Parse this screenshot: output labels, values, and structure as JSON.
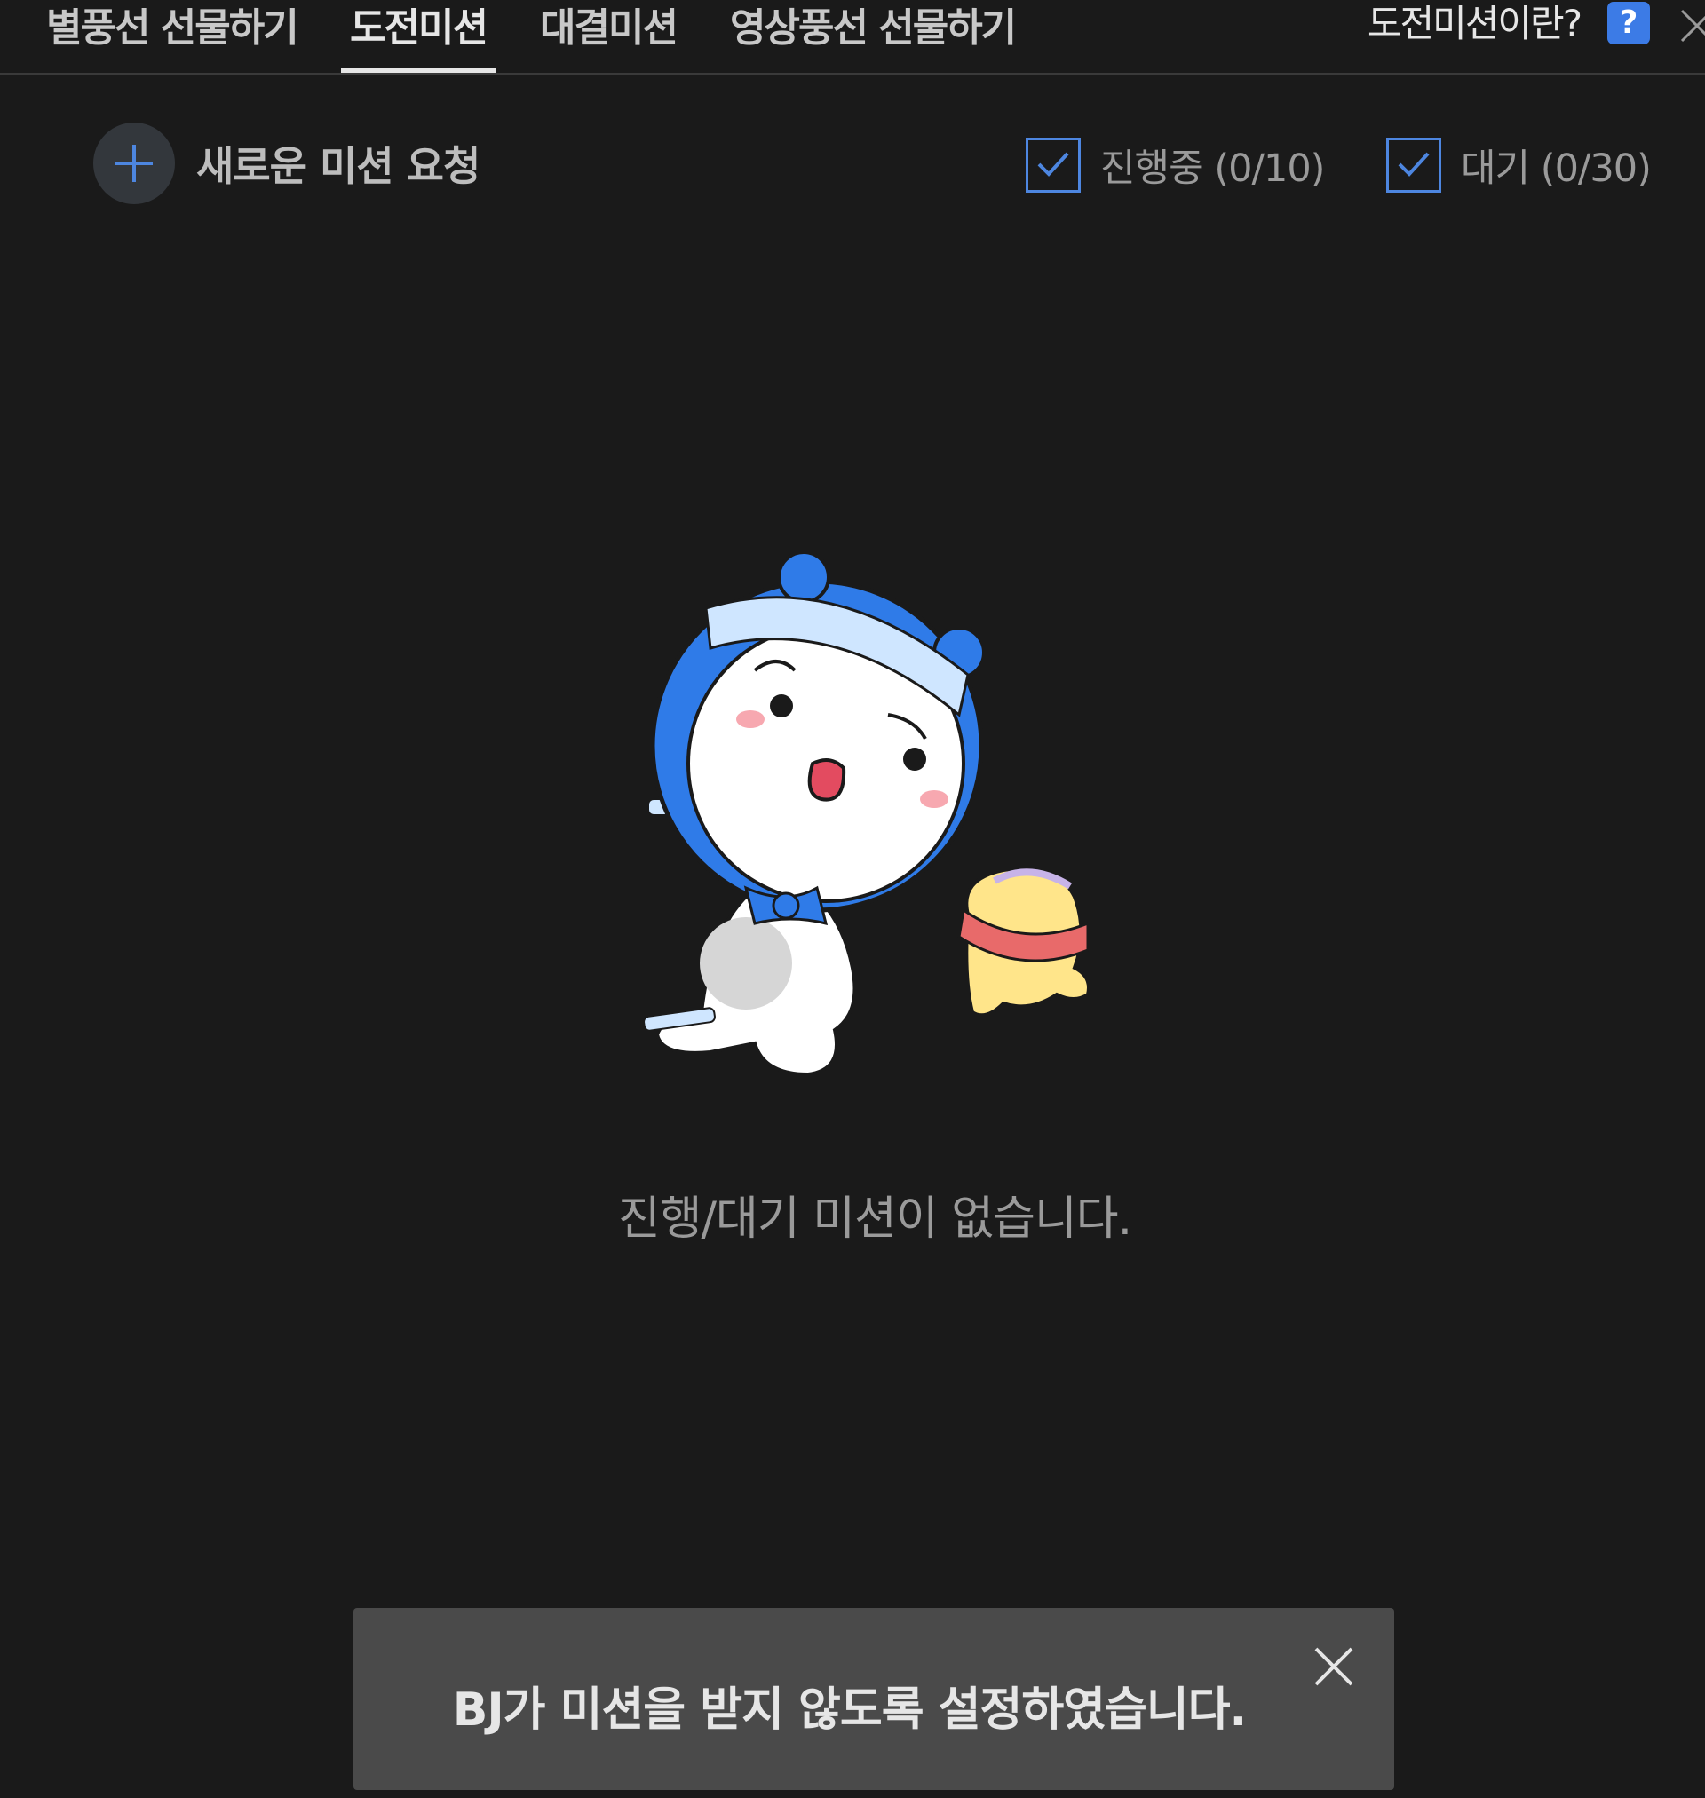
{
  "tabs": [
    {
      "label": "별풍선 선물하기",
      "active": false
    },
    {
      "label": "도전미션",
      "active": true
    },
    {
      "label": "대결미션",
      "active": false
    },
    {
      "label": "영상풍선 선물하기",
      "active": false
    }
  ],
  "header": {
    "help_label": "도전미션이란?",
    "help_icon_text": "?",
    "help_icon": "question-icon",
    "close_icon": "close-icon"
  },
  "toolbar": {
    "new_mission_label": "새로운 미션 요청",
    "new_mission_icon": "plus-icon",
    "filters": [
      {
        "label": "진행중 (0/10)",
        "checked": true
      },
      {
        "label": "대기 (0/30)",
        "checked": true
      }
    ]
  },
  "empty_state": {
    "message": "진행/대기 미션이 없습니다."
  },
  "toast": {
    "message": "BJ가 미션을 받지 않도록 설정하였습니다.",
    "close_icon": "close-icon"
  },
  "colors": {
    "background": "#1a1a1a",
    "accent": "#4d86e0",
    "toast_bg": "#4a4a4a",
    "help_icon_bg": "#3c7be6"
  }
}
